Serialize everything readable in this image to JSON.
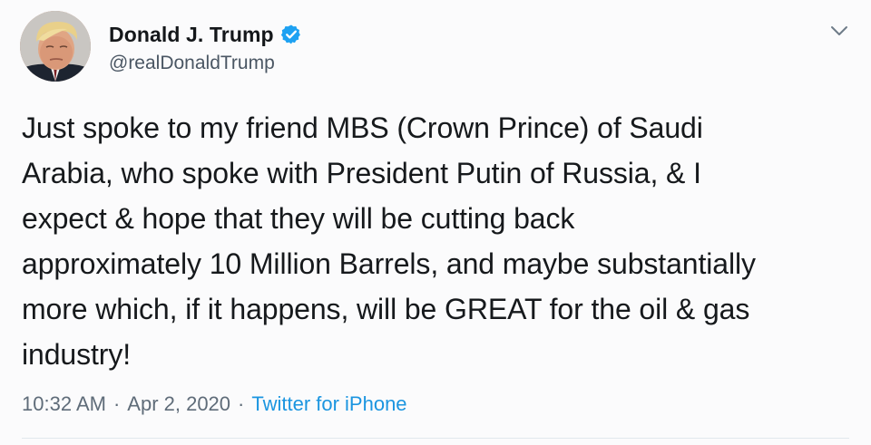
{
  "author": {
    "display_name": "Donald J. Trump",
    "handle": "@realDonaldTrump",
    "verified": true,
    "verified_icon": "verified-check-icon",
    "avatar": "profile-photo"
  },
  "tweet": {
    "text": "Just spoke to my friend MBS (Crown Prince) of Saudi\nArabia, who spoke with President Putin of Russia, & I\nexpect & hope that they will be cutting back\napproximately 10 Million Barrels, and maybe substantially\nmore which, if it happens, will be GREAT for the oil & gas\nindustry!",
    "time": "10:32 AM",
    "separator": "·",
    "date": "Apr 2, 2020",
    "source": "Twitter for iPhone"
  },
  "menu": {
    "icon": "chevron-down-icon"
  },
  "colors": {
    "link": "#1b95e0",
    "verified": "#1da1f2",
    "text": "#14171a",
    "muted": "#5f6c79"
  }
}
